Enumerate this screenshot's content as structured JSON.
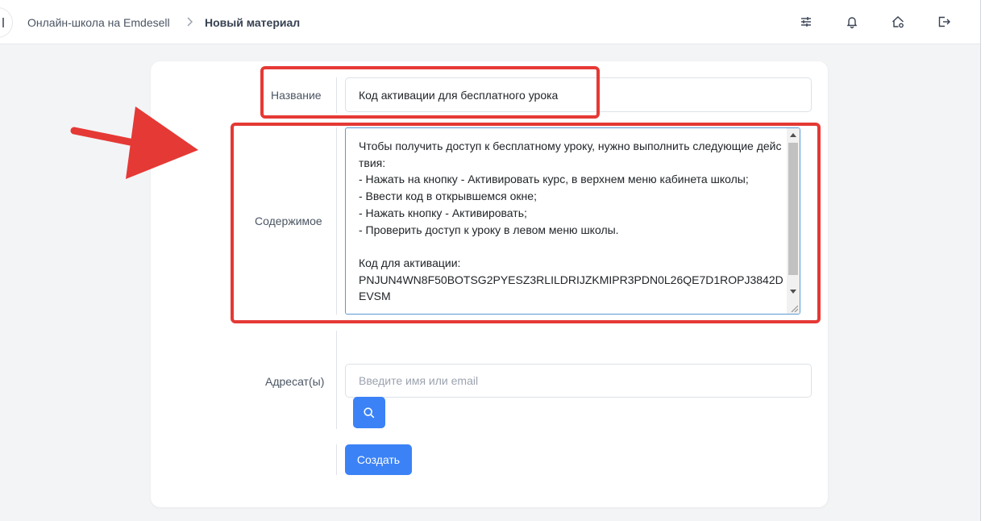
{
  "breadcrumb": {
    "parent": "Онлайн-школа на Emdesell",
    "current": "Новый материал"
  },
  "toolbar": {
    "icons": [
      "sliders-icon",
      "bell-icon",
      "home-settings-icon",
      "logout-icon"
    ]
  },
  "form": {
    "title_label": "Название",
    "title_value": "Код активации для бесплатного урока",
    "content_label": "Содержимое",
    "content_value": "Чтобы получить доступ к бесплатному уроку, нужно выполнить следующие действия:\n- Нажать на кнопку - Активировать курс, в верхнем меню кабинета школы;\n- Ввести код в открывшемся окне;\n- Нажать кнопку - Активировать;\n- Проверить доступ к уроку в левом меню школы.\n\nКод для активации:\nPNJUN4WN8F50BOTSG2PYESZ3RLILDRIJZKMIPR3PDN0L26QE7D1ROPJ3842DEVSM",
    "recipients_label": "Адресат(ы)",
    "recipients_placeholder": "Введите имя или email",
    "submit_label": "Создать"
  },
  "colors": {
    "accent": "#3b82f6",
    "highlight": "#e53935"
  }
}
